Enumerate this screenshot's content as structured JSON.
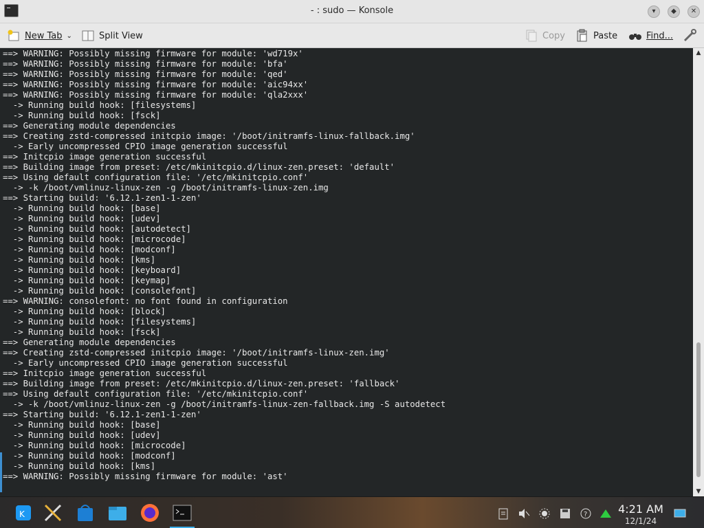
{
  "window": {
    "title": "- : sudo — Konsole"
  },
  "toolbar": {
    "new_tab_label": "New Tab",
    "split_view_label": "Split View",
    "copy_label": "Copy",
    "paste_label": "Paste",
    "find_label": "Find..."
  },
  "terminal": {
    "lines": [
      "==> WARNING: Possibly missing firmware for module: 'wd719x'",
      "==> WARNING: Possibly missing firmware for module: 'bfa'",
      "==> WARNING: Possibly missing firmware for module: 'qed'",
      "==> WARNING: Possibly missing firmware for module: 'aic94xx'",
      "==> WARNING: Possibly missing firmware for module: 'qla2xxx'",
      "  -> Running build hook: [filesystems]",
      "  -> Running build hook: [fsck]",
      "==> Generating module dependencies",
      "==> Creating zstd-compressed initcpio image: '/boot/initramfs-linux-fallback.img'",
      "  -> Early uncompressed CPIO image generation successful",
      "==> Initcpio image generation successful",
      "==> Building image from preset: /etc/mkinitcpio.d/linux-zen.preset: 'default'",
      "==> Using default configuration file: '/etc/mkinitcpio.conf'",
      "  -> -k /boot/vmlinuz-linux-zen -g /boot/initramfs-linux-zen.img",
      "==> Starting build: '6.12.1-zen1-1-zen'",
      "  -> Running build hook: [base]",
      "  -> Running build hook: [udev]",
      "  -> Running build hook: [autodetect]",
      "  -> Running build hook: [microcode]",
      "  -> Running build hook: [modconf]",
      "  -> Running build hook: [kms]",
      "  -> Running build hook: [keyboard]",
      "  -> Running build hook: [keymap]",
      "  -> Running build hook: [consolefont]",
      "==> WARNING: consolefont: no font found in configuration",
      "  -> Running build hook: [block]",
      "  -> Running build hook: [filesystems]",
      "  -> Running build hook: [fsck]",
      "==> Generating module dependencies",
      "==> Creating zstd-compressed initcpio image: '/boot/initramfs-linux-zen.img'",
      "  -> Early uncompressed CPIO image generation successful",
      "==> Initcpio image generation successful",
      "==> Building image from preset: /etc/mkinitcpio.d/linux-zen.preset: 'fallback'",
      "==> Using default configuration file: '/etc/mkinitcpio.conf'",
      "  -> -k /boot/vmlinuz-linux-zen -g /boot/initramfs-linux-zen-fallback.img -S autodetect",
      "==> Starting build: '6.12.1-zen1-1-zen'",
      "  -> Running build hook: [base]",
      "  -> Running build hook: [udev]",
      "  -> Running build hook: [microcode]",
      "  -> Running build hook: [modconf]",
      "  -> Running build hook: [kms]",
      "==> WARNING: Possibly missing firmware for module: 'ast'"
    ]
  },
  "taskbar": {
    "apps": [
      "kde-menu-icon",
      "tools-icon",
      "store-icon",
      "files-icon",
      "firefox-icon",
      "konsole-icon"
    ],
    "tray": [
      "clipboard-icon",
      "volume-muted-icon",
      "brightness-icon",
      "storage-icon",
      "help-icon",
      "network-icon"
    ],
    "clock_time": "4:21 AM",
    "clock_date": "12/1/24"
  },
  "colors": {
    "terminal_bg": "#232627",
    "terminal_fg": "#e8e8e8",
    "accent": "#3d8fd1"
  }
}
